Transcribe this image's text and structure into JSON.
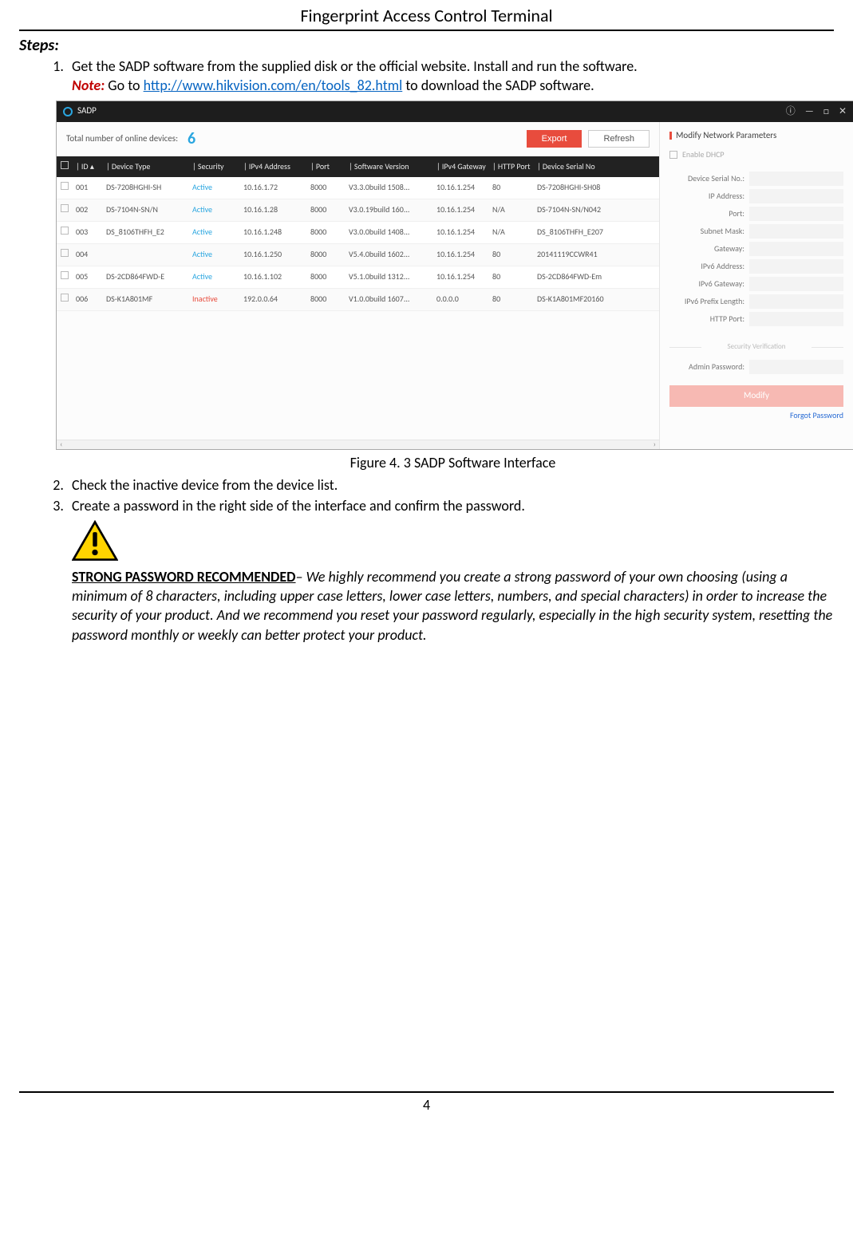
{
  "doc": {
    "title": "Fingerprint Access Control Terminal",
    "steps_heading": "Steps:",
    "page_number": "4",
    "note_label": "Note:",
    "link_url": "http://www.hikvision.com/en/tools_82.html",
    "step_items": {
      "s1a": "Get the SADP software from the supplied disk or the official website. Install and run the software.",
      "s1b_pre": " Go to ",
      "s1b_post": " to download the SADP software.",
      "s2": "Check the inactive device from the device list.",
      "s3": "Create a password in the right side of the interface and confirm the password."
    },
    "figure_caption": "Figure 4. 3 SADP Software Interface",
    "warn_strong": "STRONG PASSWORD RECOMMENDED",
    "warn_text": "– We highly recommend you create a strong password of your own choosing (using a minimum of 8 characters, including upper case letters, lower case letters, numbers, and special characters) in order to increase the security of your product. And we recommend you reset your password regularly, especially in the high security system, resetting the password monthly or weekly can better protect your product."
  },
  "sadp": {
    "app_name": "SADP",
    "total_label": "Total number of online devices:",
    "count": "6",
    "export_btn": "Export",
    "refresh_btn": "Refresh",
    "headers": {
      "id": "ID",
      "type": "Device Type",
      "sec": "Security",
      "ip": "IPv4 Address",
      "port": "Port",
      "ver": "Software Version",
      "gw": "IPv4 Gateway",
      "http": "HTTP Port",
      "ser": "Device Serial No"
    },
    "rows": [
      {
        "id": "001",
        "type": "DS-7208HGHI-SH",
        "sec": "Active",
        "ip": "10.16.1.72",
        "port": "8000",
        "ver": "V3.3.0build 1508...",
        "gw": "10.16.1.254",
        "http": "80",
        "ser": "DS-7208HGHI-SH08"
      },
      {
        "id": "002",
        "type": "DS-7104N-SN/N",
        "sec": "Active",
        "ip": "10.16.1.28",
        "port": "8000",
        "ver": "V3.0.19build 160...",
        "gw": "10.16.1.254",
        "http": "N/A",
        "ser": "DS-7104N-SN/N042"
      },
      {
        "id": "003",
        "type": "DS_8106THFH_E2",
        "sec": "Active",
        "ip": "10.16.1.248",
        "port": "8000",
        "ver": "V3.0.0build 1408...",
        "gw": "10.16.1.254",
        "http": "N/A",
        "ser": "DS_8106THFH_E207"
      },
      {
        "id": "004",
        "type": "",
        "sec": "Active",
        "ip": "10.16.1.250",
        "port": "8000",
        "ver": "V5.4.0build 1602...",
        "gw": "10.16.1.254",
        "http": "80",
        "ser": "20141119CCWR41"
      },
      {
        "id": "005",
        "type": "DS-2CD864FWD-E",
        "sec": "Active",
        "ip": "10.16.1.102",
        "port": "8000",
        "ver": "V5.1.0build 1312...",
        "gw": "10.16.1.254",
        "http": "80",
        "ser": "DS-2CD864FWD-Em"
      },
      {
        "id": "006",
        "type": "DS-K1A801MF",
        "sec": "Inactive",
        "ip": "192.0.0.64",
        "port": "8000",
        "ver": "V1.0.0build 1607...",
        "gw": "0.0.0.0",
        "http": "80",
        "ser": "DS-K1A801MF20160"
      }
    ],
    "panel": {
      "title": "Modify Network Parameters",
      "dhcp": "Enable DHCP",
      "fields": [
        "Device Serial No.:",
        "IP Address:",
        "Port:",
        "Subnet Mask:",
        "Gateway:",
        "IPv6 Address:",
        "IPv6 Gateway:",
        "IPv6 Prefix Length:",
        "HTTP Port:"
      ],
      "sec_ver": "Security Verification",
      "admin_pwd": "Admin Password:",
      "modify": "Modify",
      "forgot": "Forgot Password"
    }
  }
}
